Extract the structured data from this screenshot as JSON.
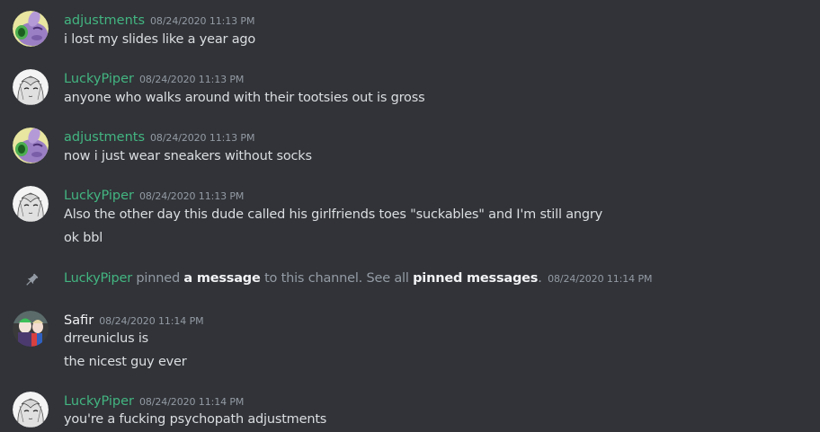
{
  "colors": {
    "background": "#313338",
    "author_green": "#43b581",
    "author_white": "#f2f3f5",
    "timestamp": "#949ba4",
    "text": "#dbdee1"
  },
  "messages": [
    {
      "author": "adjustments",
      "timestamp": "08/24/2020 11:13 PM",
      "avatar": "purple-creature-avatar",
      "lines": [
        "i lost my slides like a year ago"
      ]
    },
    {
      "author": "LuckyPiper",
      "timestamp": "08/24/2020 11:13 PM",
      "avatar": "anime-girl-avatar",
      "lines": [
        "anyone who walks around with their tootsies out is gross"
      ]
    },
    {
      "author": "adjustments",
      "timestamp": "08/24/2020 11:13 PM",
      "avatar": "purple-creature-avatar",
      "lines": [
        "now i just wear sneakers without socks"
      ]
    },
    {
      "author": "LuckyPiper",
      "timestamp": "08/24/2020 11:13 PM",
      "avatar": "anime-girl-avatar",
      "lines": [
        "Also the other day this dude called his girlfriends toes \"suckables\" and I'm still angry",
        "ok bbl"
      ]
    },
    {
      "author": "Safir",
      "timestamp": "08/24/2020 11:14 PM",
      "avatar": "joker-harley-avatar",
      "lines": [
        "drreuniclus is",
        "the nicest guy ever"
      ]
    },
    {
      "author": "LuckyPiper",
      "timestamp": "08/24/2020 11:14 PM",
      "avatar": "anime-girl-avatar",
      "lines": [
        "you're a fucking psychopath adjustments"
      ]
    }
  ],
  "pin_notice": {
    "icon": "pin-icon",
    "author": "LuckyPiper",
    "text_before": "pinned",
    "link_message": "a message",
    "text_middle": "to this channel. See all",
    "link_pinned": "pinned messages",
    "text_after": ".",
    "timestamp": "08/24/2020 11:14 PM"
  }
}
